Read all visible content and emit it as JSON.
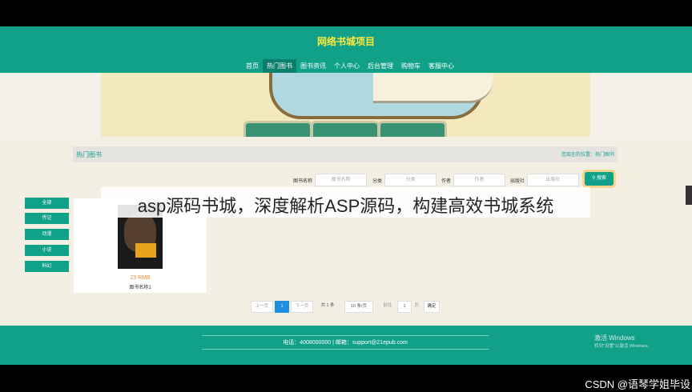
{
  "header": {
    "site_title": "网络书城项目"
  },
  "nav": {
    "items": [
      "首页",
      "热门图书",
      "图书资讯",
      "个人中心",
      "后台管理",
      "购物车",
      "客服中心"
    ],
    "active": 1
  },
  "breadcrumb": {
    "section": "热门图书",
    "location": "您现在的位置：热门图书"
  },
  "search": {
    "fields": [
      {
        "label": "图书名称",
        "placeholder": "图书名称"
      },
      {
        "label": "分类",
        "placeholder": "分类"
      },
      {
        "label": "作者",
        "placeholder": "作者"
      },
      {
        "label": "出版社",
        "placeholder": "出版社"
      }
    ],
    "button": "搜索"
  },
  "categories": [
    "全部",
    "传记",
    "动漫",
    "小说",
    "科幻"
  ],
  "book": {
    "price": "23 RMB",
    "name": "图书名称1"
  },
  "pagination": {
    "prev": "上一页",
    "current": "1",
    "next": "下一页",
    "total": "共 1 条",
    "per_page": "10 条/页",
    "goto_label": "前往",
    "goto_value": "1",
    "page_unit": "页",
    "confirm": "确定"
  },
  "overlay": {
    "title": "asp源码书城，深度解析ASP源码，构建高效书城系统"
  },
  "footer": {
    "contact": "电话：4008000000 | 邮箱：support@21epub.com",
    "win_title": "激活 Windows",
    "win_sub": "转到\"设置\"以激活 Windows。"
  },
  "watermark": {
    "text": "CSDN @语琴学姐毕设"
  },
  "colors": {
    "brand": "#11a088",
    "accent": "#ffe93b",
    "page_active": "#1e8fe0"
  }
}
